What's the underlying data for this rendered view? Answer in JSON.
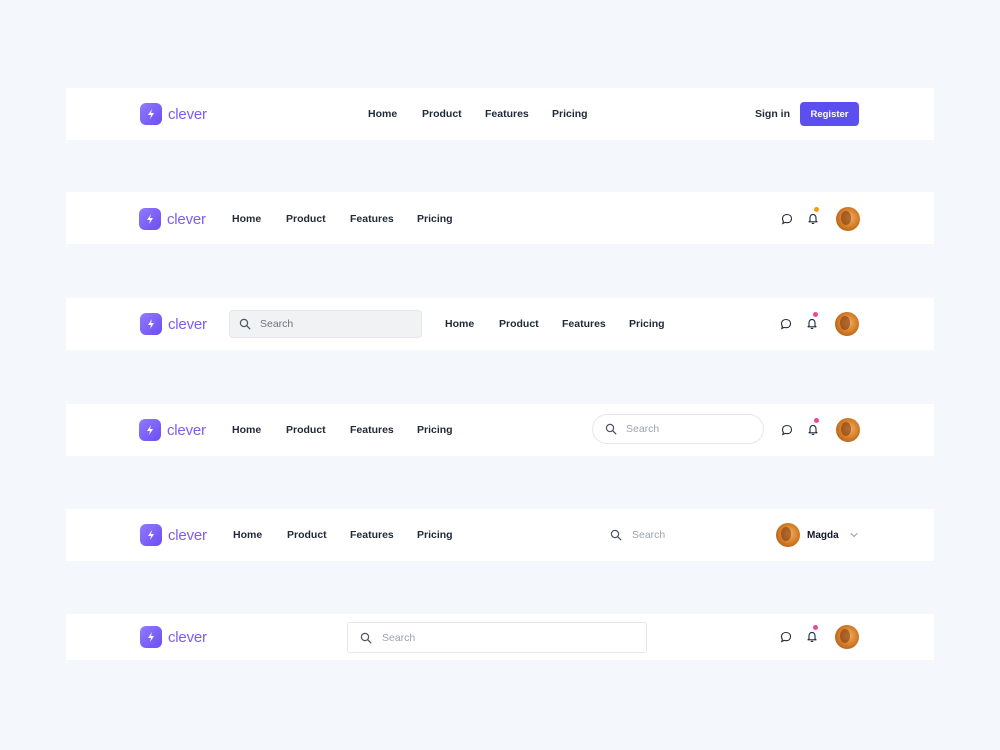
{
  "brand": {
    "name": "clever"
  },
  "nav": {
    "home": "Home",
    "product": "Product",
    "features": "Features",
    "pricing": "Pricing"
  },
  "auth": {
    "sign_in": "Sign in",
    "register": "Register"
  },
  "search": {
    "placeholder": "Search"
  },
  "user": {
    "name": "Magda"
  },
  "colors": {
    "background": "#f4f7fb",
    "brand": "#7c5cf5",
    "register_button": "#5b4ff0",
    "notification_orange": "#f59e0b",
    "notification_pink": "#ec4899"
  },
  "icons": [
    "lightning-icon",
    "search-icon",
    "chat-icon",
    "bell-icon",
    "chevron-down-icon"
  ]
}
